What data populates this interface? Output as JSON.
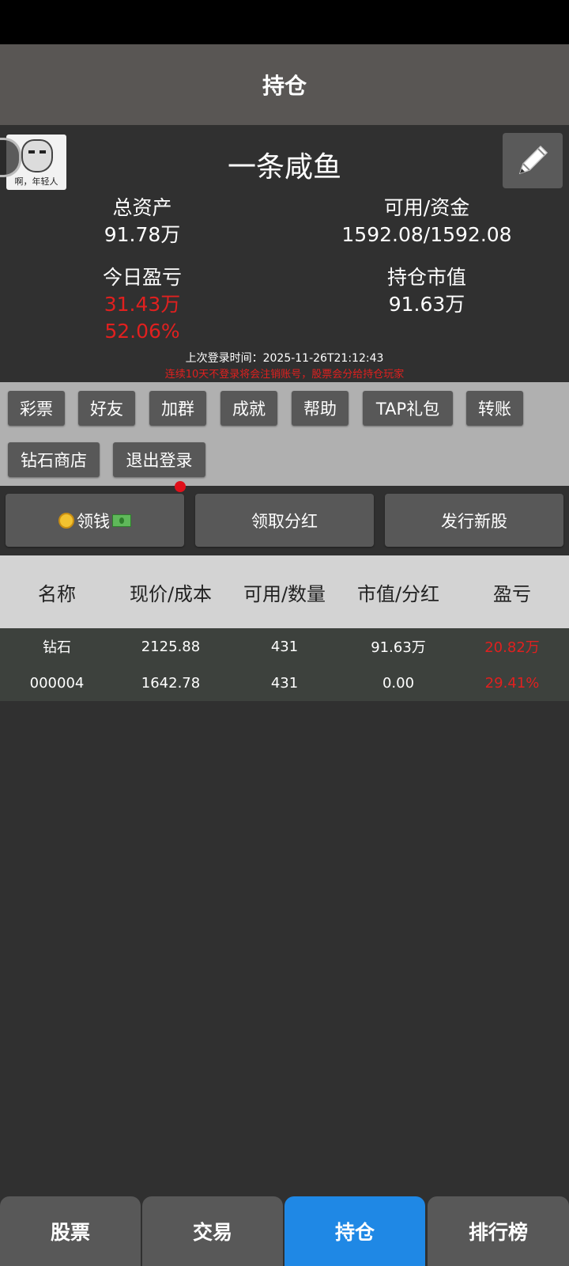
{
  "header": {
    "title": "持仓"
  },
  "profile": {
    "avatar_caption": "啊，年轻人",
    "nickname": "一条咸鱼",
    "total_assets_label": "总资产",
    "total_assets_value": "91.78万",
    "available_label": "可用/资金",
    "available_value": "1592.08/1592.08",
    "today_pnl_label": "今日盈亏",
    "today_pnl_value": "31.43万",
    "today_pnl_percent": "52.06%",
    "market_value_label": "持仓市值",
    "market_value_value": "91.63万",
    "last_login": "上次登录时间：2025-11-26T21:12:43",
    "warning": "连续10天不登录将会注销账号，股票会分给持仓玩家"
  },
  "menu": {
    "items": [
      "彩票",
      "好友",
      "加群",
      "成就",
      "帮助",
      "TAP礼包",
      "转账",
      "钻石商店",
      "退出登录"
    ]
  },
  "actions": {
    "collect_money": "领钱",
    "collect_dividend": "领取分红",
    "issue_stock": "发行新股"
  },
  "table": {
    "headers": [
      "名称",
      "现价/成本",
      "可用/数量",
      "市值/分红",
      "盈亏"
    ],
    "rows": [
      [
        "钻石",
        "2125.88",
        "431",
        "91.63万",
        "20.82万"
      ],
      [
        "000004",
        "1642.78",
        "431",
        "0.00",
        "29.41%"
      ]
    ]
  },
  "bottom_nav": {
    "tabs": [
      "股票",
      "交易",
      "持仓",
      "排行榜"
    ],
    "active": "持仓"
  },
  "colors": {
    "accent": "#1f88e5",
    "loss_red": "#e0201f",
    "header_bg": "#595654",
    "background": "#303030"
  }
}
